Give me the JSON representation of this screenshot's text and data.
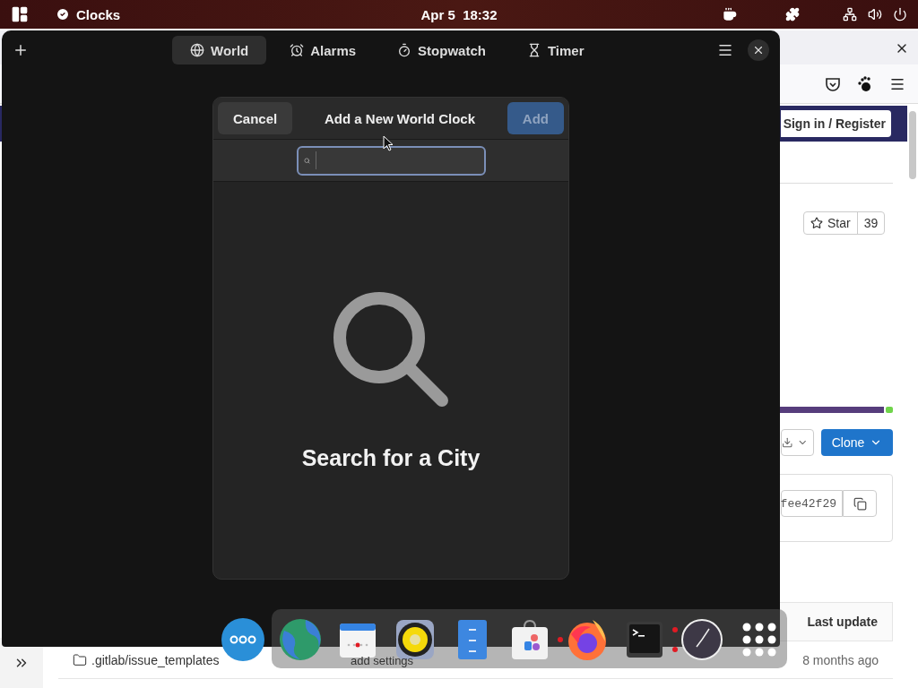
{
  "top_bar": {
    "app_name": "Clocks",
    "clock": "Apr 5  18:32"
  },
  "browser": {
    "sign_in": "Sign in / Register",
    "star": {
      "label": "Star",
      "count": "39"
    },
    "clone": "Clone",
    "commit": "fee42f29",
    "table": {
      "column_header": "Last update",
      "rows": [
        {
          "name": ".gitlab/issue_templates",
          "updated": "8 months ago"
        }
      ]
    },
    "hidden_text": "add settings"
  },
  "clocks": {
    "tabs": [
      {
        "label": "World",
        "kind": "globe",
        "selected": true
      },
      {
        "label": "Alarms",
        "kind": "alarm",
        "selected": false
      },
      {
        "label": "Stopwatch",
        "kind": "stopwatch",
        "selected": false
      },
      {
        "label": "Timer",
        "kind": "hourglass",
        "selected": false
      }
    ],
    "dialog": {
      "cancel": "Cancel",
      "title": "Add a New World Clock",
      "add": {
        "label": "Add",
        "disabled": true
      },
      "empty_state": "Search for a City"
    }
  },
  "dock": {
    "items": [
      {
        "kind": "more",
        "running": false,
        "multiple_windows": false
      },
      {
        "kind": "globe",
        "running": false,
        "multiple_windows": false
      },
      {
        "kind": "calendar",
        "running": false,
        "multiple_windows": false
      },
      {
        "kind": "speaker",
        "running": false,
        "multiple_windows": false
      },
      {
        "kind": "files",
        "running": false,
        "multiple_windows": false
      },
      {
        "kind": "store",
        "running": false,
        "multiple_windows": false
      },
      {
        "kind": "firefox",
        "running": true,
        "multiple_windows": false
      },
      {
        "kind": "terminal",
        "running": false,
        "multiple_windows": false
      },
      {
        "kind": "clock",
        "running": true,
        "multiple_windows": true
      },
      {
        "kind": "grid",
        "running": false,
        "multiple_windows": false
      }
    ]
  }
}
